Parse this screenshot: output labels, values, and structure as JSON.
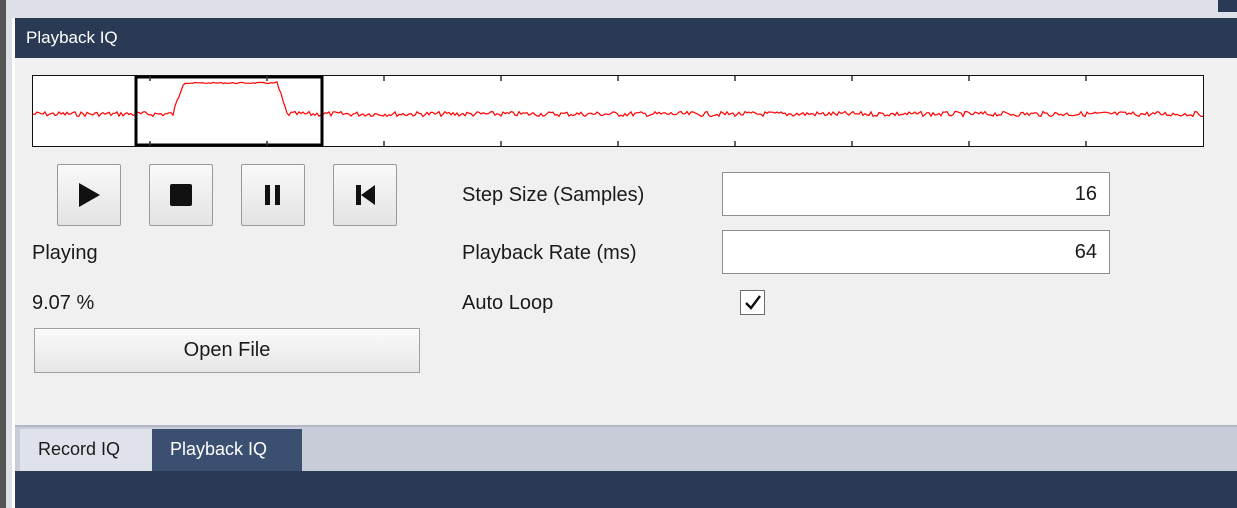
{
  "window": {
    "title": "Playback IQ"
  },
  "colors": {
    "titlebar": "#2a3a55",
    "signal": "#ff0000",
    "active_tab": "#3b5070"
  },
  "controls": {
    "play_icon": "play-icon",
    "stop_icon": "stop-icon",
    "pause_icon": "pause-icon",
    "rewind_icon": "skip-to-start-icon"
  },
  "status": {
    "state": "Playing",
    "progress": "9.07 %",
    "progress_fraction": 0.0907
  },
  "open_file_label": "Open File",
  "settings": {
    "step_size_label": "Step Size (Samples)",
    "step_size_value": "16",
    "playback_rate_label": "Playback Rate (ms)",
    "playback_rate_value": "64",
    "auto_loop_label": "Auto Loop",
    "auto_loop_checked": true
  },
  "tabs": [
    {
      "label": "Record IQ",
      "active": false
    },
    {
      "label": "Playback IQ",
      "active": true
    }
  ]
}
